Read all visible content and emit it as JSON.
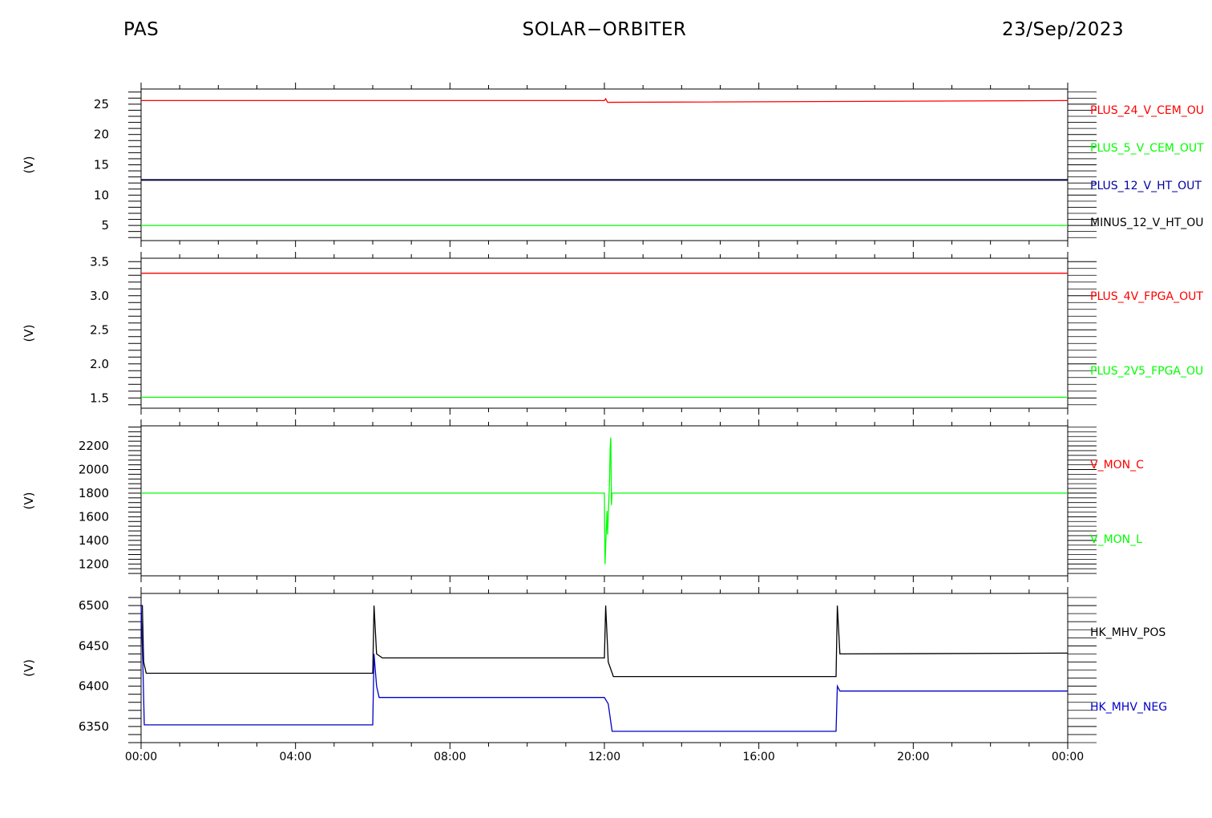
{
  "header": {
    "left": "PAS",
    "center": "SOLAR−ORBITER",
    "right": "23/Sep/2023"
  },
  "chart_data": [
    {
      "type": "line",
      "ylabel": "(V)",
      "ylim": [
        2.5,
        27.5
      ],
      "yticks": [
        5,
        10,
        15,
        20,
        25
      ],
      "xlim": [
        "00:00",
        "24:00"
      ],
      "legend_placement": "right",
      "series": [
        {
          "name": "PLUS_24_V_CEM_OU",
          "color": "#ff0000",
          "x": [
            "00:00",
            "12:00",
            "12:02",
            "12:05",
            "24:00"
          ],
          "y": [
            25.6,
            25.6,
            25.9,
            25.3,
            25.6
          ]
        },
        {
          "name": "PLUS_5_V_CEM_OUT",
          "color": "#00ff00",
          "x": [
            "00:00",
            "24:00"
          ],
          "y": [
            5.0,
            5.0
          ]
        },
        {
          "name": "PLUS_12_V_HT_OUT",
          "color": "#0000a0",
          "x": [
            "00:00",
            "24:00"
          ],
          "y": [
            12.5,
            12.5
          ]
        },
        {
          "name": "MINUS_12_V_HT_OU",
          "color": "#000000",
          "x": [
            "00:00",
            "24:00"
          ],
          "y": [
            12.5,
            12.5
          ]
        }
      ]
    },
    {
      "type": "line",
      "ylabel": "(V)",
      "ylim": [
        1.35,
        3.55
      ],
      "yticks": [
        1.5,
        2.0,
        2.5,
        3.0,
        3.5
      ],
      "xlim": [
        "00:00",
        "24:00"
      ],
      "legend_placement": "right",
      "series": [
        {
          "name": "PLUS_4V_FPGA_OUT",
          "color": "#ff0000",
          "x": [
            "00:00",
            "24:00"
          ],
          "y": [
            3.33,
            3.33
          ]
        },
        {
          "name": "PLUS_2V5_FPGA_OU",
          "color": "#00ff00",
          "x": [
            "00:00",
            "24:00"
          ],
          "y": [
            1.51,
            1.51
          ]
        }
      ]
    },
    {
      "type": "line",
      "ylabel": "(V)",
      "ylim": [
        1100,
        2370
      ],
      "yticks": [
        1200,
        1400,
        1600,
        1800,
        2000,
        2200
      ],
      "xlim": [
        "00:00",
        "24:00"
      ],
      "legend_placement": "right",
      "series": [
        {
          "name": "V_MON_C",
          "color": "#ff0000",
          "x": [
            "12:10",
            "12:11"
          ],
          "y": [
            2050,
            2050
          ]
        },
        {
          "name": "V_MON_L",
          "color": "#00ff00",
          "x": [
            "00:00",
            "12:00",
            "12:01",
            "12:04",
            "12:05",
            "12:08",
            "12:09",
            "12:10",
            "12:11",
            "12:12",
            "24:00"
          ],
          "y": [
            1800,
            1800,
            1200,
            1650,
            1450,
            1900,
            2180,
            2270,
            1700,
            1800,
            1800
          ]
        }
      ]
    },
    {
      "type": "line",
      "ylabel": "(V)",
      "ylim": [
        6330,
        6515
      ],
      "yticks": [
        6350,
        6400,
        6450,
        6500
      ],
      "xticks": [
        "00:00",
        "04:00",
        "08:00",
        "12:00",
        "16:00",
        "20:00",
        "00:00"
      ],
      "xlim": [
        "00:00",
        "24:00"
      ],
      "legend_placement": "right",
      "series": [
        {
          "name": "HK_MHV_POS",
          "color": "#000000",
          "x": [
            "00:00",
            "00:02",
            "00:04",
            "00:08",
            "06:00",
            "06:02",
            "06:06",
            "06:15",
            "12:00",
            "12:02",
            "12:06",
            "12:14",
            "18:00",
            "18:02",
            "18:06",
            "24:00"
          ],
          "y": [
            6500,
            6500,
            6430,
            6416,
            6416,
            6500,
            6440,
            6435,
            6435,
            6500,
            6430,
            6412,
            6412,
            6500,
            6440,
            6441
          ]
        },
        {
          "name": "HK_MHV_NEG",
          "color": "#0000c8",
          "x": [
            "00:00",
            "00:03",
            "00:05",
            "06:00",
            "06:02",
            "06:06",
            "06:10",
            "12:00",
            "12:06",
            "12:12",
            "18:00",
            "18:02",
            "18:06",
            "24:00"
          ],
          "y": [
            6500,
            6420,
            6352,
            6352,
            6440,
            6400,
            6386,
            6386,
            6378,
            6344,
            6344,
            6400,
            6394,
            6394
          ]
        }
      ]
    }
  ]
}
